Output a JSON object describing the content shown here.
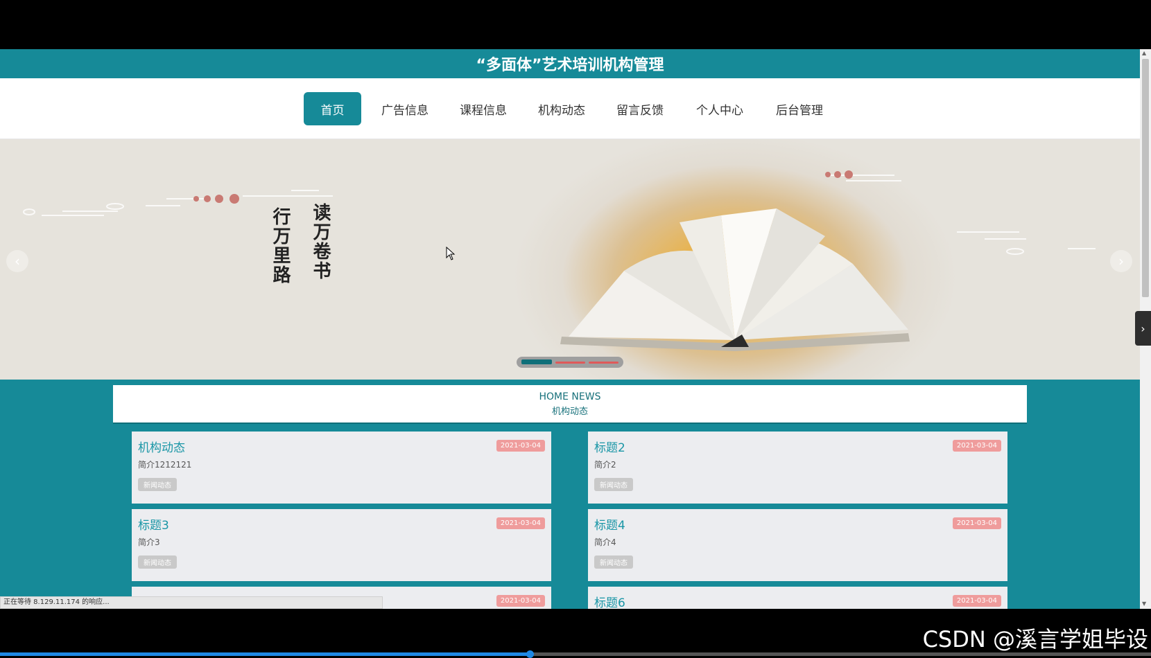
{
  "site": {
    "title": "“多面体”艺术培训机构管理"
  },
  "nav": {
    "items": [
      {
        "label": "首页",
        "active": true
      },
      {
        "label": "广告信息",
        "active": false
      },
      {
        "label": "课程信息",
        "active": false
      },
      {
        "label": "机构动态",
        "active": false
      },
      {
        "label": "留言反馈",
        "active": false
      },
      {
        "label": "个人中心",
        "active": false
      },
      {
        "label": "后台管理",
        "active": false
      }
    ]
  },
  "carousel": {
    "poem_line_right": "读万卷书",
    "poem_line_left": "行万里路",
    "prev_icon": "chevron-left-icon",
    "next_icon": "chevron-right-icon",
    "active_index": 0,
    "slide_count": 3
  },
  "news": {
    "title_en": "HOME NEWS",
    "title_cn": "机构动态",
    "items": [
      {
        "title": "机构动态",
        "date": "2021-03-04",
        "desc": "简介1212121",
        "tag": "新闻动态"
      },
      {
        "title": "标题2",
        "date": "2021-03-04",
        "desc": "简介2",
        "tag": "新闻动态"
      },
      {
        "title": "标题3",
        "date": "2021-03-04",
        "desc": "简介3",
        "tag": "新闻动态"
      },
      {
        "title": "标题4",
        "date": "2021-03-04",
        "desc": "简介4",
        "tag": "新闻动态"
      },
      {
        "title": "",
        "date": "2021-03-04",
        "desc": "",
        "tag": ""
      },
      {
        "title": "标题6",
        "date": "2021-03-04",
        "desc": "",
        "tag": ""
      }
    ]
  },
  "status": {
    "text": "正在等待 8.129.11.174 的响应..."
  },
  "side_tab": {
    "icon": "chevron-right-icon"
  },
  "watermark": {
    "text": "CSDN @溪言学姐毕设"
  },
  "video": {
    "progress_fraction": 0.46
  },
  "colors": {
    "primary": "#168a98",
    "date_badge": "#ef9c9c",
    "tag_badge": "#c9c9c9"
  }
}
